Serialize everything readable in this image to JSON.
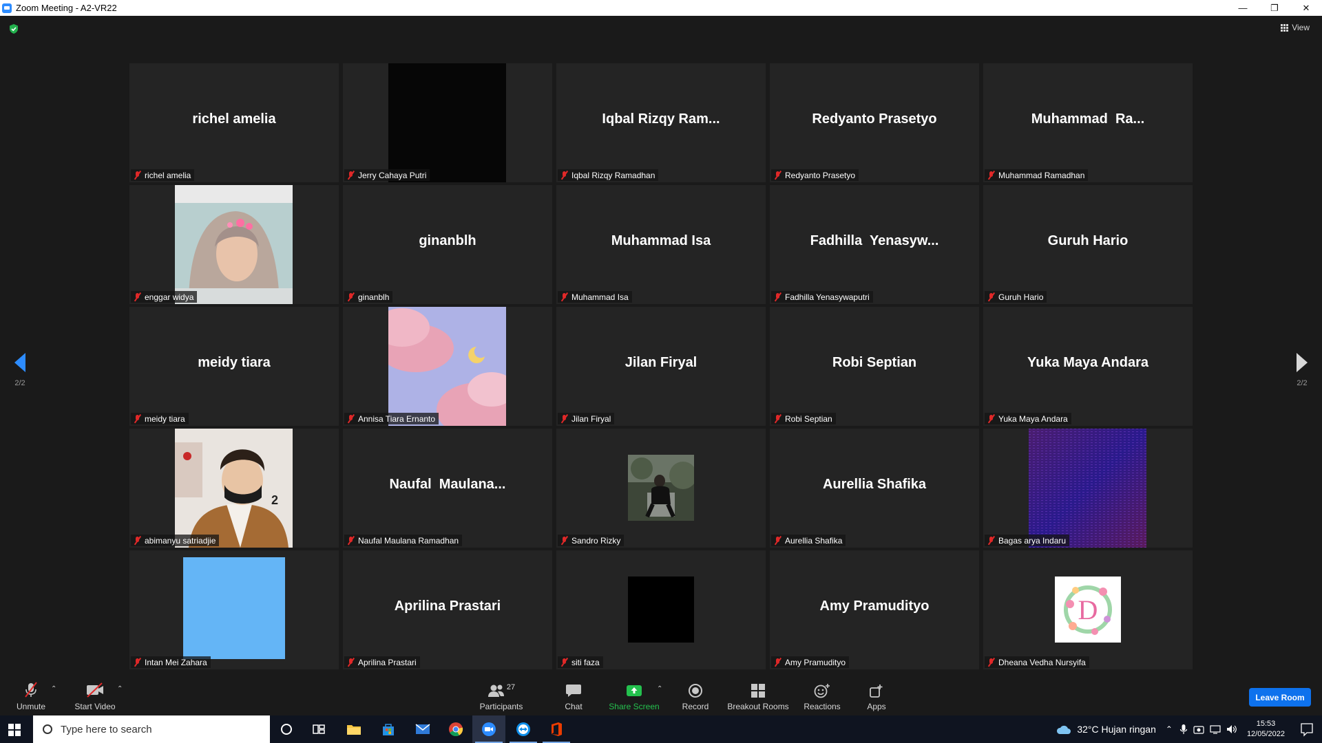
{
  "window": {
    "title": "Zoom Meeting - A2-VR22"
  },
  "meeting": {
    "view_label": "View",
    "page_indicator_left": "2/2",
    "page_indicator_right": "2/2"
  },
  "tiles": [
    {
      "big": "richel amelia",
      "plate": "richel amelia"
    },
    {
      "big": "",
      "plate": "Jerry Cahaya Putri",
      "media": "black"
    },
    {
      "big": "Iqbal Rizqy Ram...",
      "plate": "Iqbal Rizqy Ramadhan"
    },
    {
      "big": "Redyanto Prasetyo",
      "plate": "Redyanto Prasetyo"
    },
    {
      "big": "Muhammad  Ra...",
      "plate": "Muhammad Ramadhan"
    },
    {
      "big": "",
      "plate": "enggar widya",
      "media": "photo-hijab"
    },
    {
      "big": "ginanblh",
      "plate": "ginanblh"
    },
    {
      "big": "Muhammad Isa",
      "plate": "Muhammad Isa"
    },
    {
      "big": "Fadhilla  Yenasyw...",
      "plate": "Fadhilla Yenasywaputri"
    },
    {
      "big": "Guruh Hario",
      "plate": "Guruh Hario"
    },
    {
      "big": "meidy tiara",
      "plate": "meidy tiara"
    },
    {
      "big": "",
      "plate": "Annisa Tiara Ernanto",
      "media": "sky-clouds"
    },
    {
      "big": "Jilan Firyal",
      "plate": "Jilan Firyal"
    },
    {
      "big": "Robi Septian",
      "plate": "Robi Septian"
    },
    {
      "big": "Yuka Maya Andara",
      "plate": "Yuka Maya Andara"
    },
    {
      "big": "",
      "plate": "abimanyu satriadjie",
      "media": "photo-mask"
    },
    {
      "big": "Naufal  Maulana...",
      "plate": "Naufal Maulana Ramadhan"
    },
    {
      "big": "",
      "plate": "Sandro Rizky",
      "media": "photo-small"
    },
    {
      "big": "Aurellia Shafika",
      "plate": "Aurellia Shafika"
    },
    {
      "big": "",
      "plate": "Bagas arya Indaru",
      "media": "purple-noise"
    },
    {
      "big": "",
      "plate": "Intan Mei Zahara",
      "media": "blue-square"
    },
    {
      "big": "Aprilina Prastari",
      "plate": "Aprilina Prastari"
    },
    {
      "big": "",
      "plate": "siti faza",
      "media": "black-small"
    },
    {
      "big": "Amy Pramudityo",
      "plate": "Amy Pramudityo"
    },
    {
      "big": "",
      "plate": "Dheana Vedha Nursyifa",
      "media": "wreath-d"
    }
  ],
  "media_text": {
    "mask_number": "2",
    "wreath_letter": "D"
  },
  "toolbar": {
    "unmute": "Unmute",
    "start_video": "Start Video",
    "participants": "Participants",
    "participants_count": "27",
    "chat": "Chat",
    "share_screen": "Share Screen",
    "record": "Record",
    "breakout_rooms": "Breakout Rooms",
    "reactions": "Reactions",
    "apps": "Apps",
    "leave": "Leave Room"
  },
  "taskbar": {
    "search_placeholder": "Type here to search",
    "weather": "32°C  Hujan ringan",
    "time": "15:53",
    "date": "12/05/2022"
  },
  "colors": {
    "accent": "#2d8cff",
    "share_green": "#24c14e",
    "mute_red": "#e02828",
    "leave_blue": "#0e72ed"
  }
}
